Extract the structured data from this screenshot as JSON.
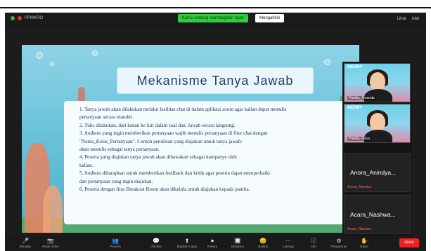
{
  "window": {
    "left_label": "PPMKRO",
    "share_banner": "Kamu sedang membagikan layar",
    "options_label": "Mengakhiri",
    "right_labels": [
      "Lihat",
      "Alat"
    ]
  },
  "slide": {
    "title": "Mekanisme Tanya Jawab",
    "lines": [
      "1. Tanya jawab akan dilakukan melalui fasilitas chat di dalam aplikasi zoom agar kalian dapat menulis",
      "    pertanyaan secara mandiri.",
      "2. Tulis dilakukan, dari kanan ke kiri dalam soal dan. Jawab secara langsung.",
      "3. Audiens yang ingin memberikan pertanyaan wajib menulis pertanyaan di fitur chat dengan",
      "    \"Nama_Kelas_Pertanyaan\". Contoh penulisan yang diajukan untuk tanya jawab:",
      "    akan menulis sebagai tanya pertanyaan.",
      "4. Peserta yang diajukan tanya jawab akan dibawakan sebagai kampanye oleh",
      "    kalian.",
      "5. Audiens diharapkan untuk memberikan feedback dan kritik agar peserta dapat memperbaiki",
      "    dan pertanyaan yang ingin diajukan.",
      "6. Peserta dengan fitur Breakout Room akan dikelola untuk diajukan kepada panitia."
    ]
  },
  "gallery": {
    "tile1_decor": "MERRY",
    "tile1_caption": "Panitia_Amanda",
    "tile2_decor": "MERRY",
    "tile2_caption": "Panitia_Kelas",
    "tile3_name": "Anora_Anindya...",
    "tile3_sub": "Anora_Anindya",
    "tile4_name": "Acara_Nashwa...",
    "tile4_sub": "Acara_Nashwa"
  },
  "toolbar": {
    "items": [
      {
        "icon": "🎤",
        "label": "Bisukan"
      },
      {
        "icon": "📷",
        "label": "Mulai Video"
      },
      {
        "icon": "👥",
        "label": "Peserta"
      },
      {
        "icon": "💬",
        "label": "Obrolan"
      },
      {
        "icon": "⬆",
        "label": "Bagikan Layar"
      },
      {
        "icon": "⏺",
        "label": "Rekam"
      },
      {
        "icon": "🔲",
        "label": "Breakout"
      },
      {
        "icon": "😊",
        "label": "Reaksi"
      },
      {
        "icon": "⋯",
        "label": "Lainnya"
      },
      {
        "icon": "ⓘ",
        "label": "Info"
      },
      {
        "icon": "⚙",
        "label": "Pengaturan"
      },
      {
        "icon": "✋",
        "label": "Raise"
      }
    ],
    "end_label": "Akhiri"
  }
}
